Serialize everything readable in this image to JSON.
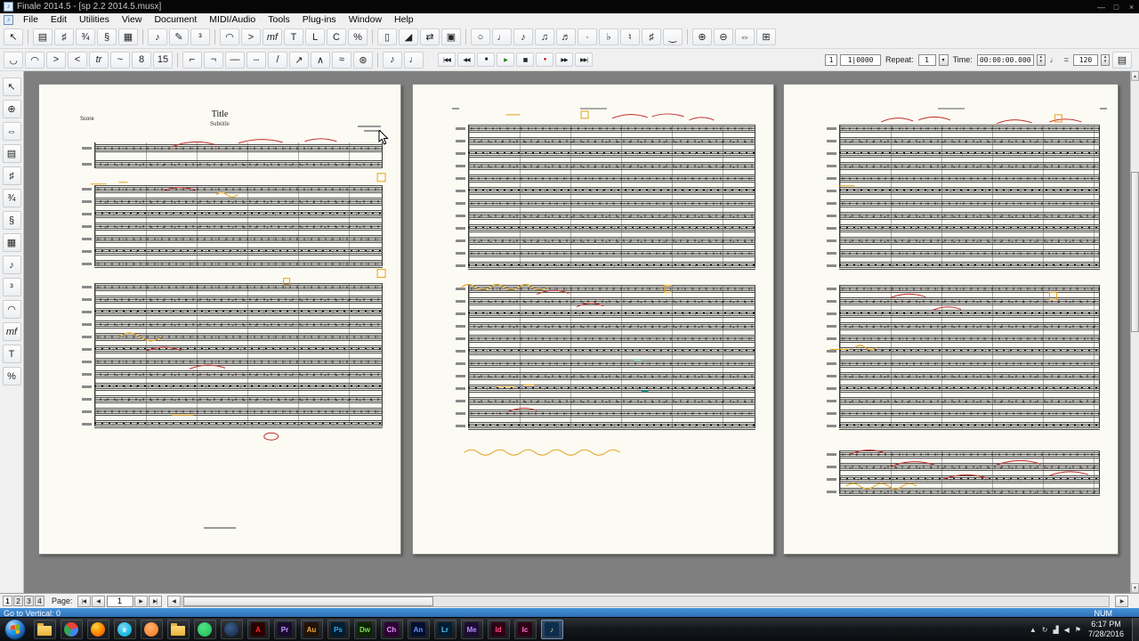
{
  "window": {
    "title": "Finale 2014.5 - [sp 2.2 2014.5.musx]",
    "icon_glyph": "♪",
    "doc_icon_glyph": "♪",
    "controls": {
      "minimize": "—",
      "restore": "□",
      "close": "×"
    }
  },
  "menu": {
    "items": [
      "File",
      "Edit",
      "Utilities",
      "View",
      "Document",
      "MIDI/Audio",
      "Tools",
      "Plug-ins",
      "Window",
      "Help"
    ]
  },
  "toolbar_main": {
    "tools": [
      {
        "name": "selection-tool",
        "glyph": "↖"
      },
      {
        "sep": true
      },
      {
        "name": "staff-tool",
        "glyph": "▤"
      },
      {
        "name": "key-signature-tool",
        "glyph": "♯"
      },
      {
        "name": "time-signature-tool",
        "glyph": "¾"
      },
      {
        "name": "clef-tool",
        "glyph": "§"
      },
      {
        "name": "measure-tool",
        "glyph": "▦"
      },
      {
        "sep": true
      },
      {
        "name": "simple-entry-tool",
        "glyph": "♪"
      },
      {
        "name": "speedy-entry-tool",
        "glyph": "✎"
      },
      {
        "name": "tuplet-tool",
        "glyph": "³"
      },
      {
        "sep": true
      },
      {
        "name": "smart-shape-tool",
        "glyph": "◠"
      },
      {
        "name": "articulation-tool",
        "glyph": ">"
      },
      {
        "name": "expression-tool",
        "glyph": "mf",
        "italic": true
      },
      {
        "name": "text-tool",
        "glyph": "T"
      },
      {
        "name": "lyrics-tool",
        "glyph": "L"
      },
      {
        "name": "chord-tool",
        "glyph": "C"
      },
      {
        "name": "repeat-tool",
        "glyph": "%"
      },
      {
        "sep": true
      },
      {
        "name": "page-layout-tool",
        "glyph": "▯"
      },
      {
        "name": "resize-tool",
        "glyph": "◢"
      },
      {
        "name": "note-mover-tool",
        "glyph": "⇄"
      },
      {
        "name": "graphics-tool",
        "glyph": "▣"
      },
      {
        "sep": true
      },
      {
        "name": "simple-entry-whole-note",
        "glyph": "○"
      },
      {
        "name": "simple-entry-quarter-note",
        "glyph": "♩"
      },
      {
        "name": "simple-entry-eighth-note",
        "glyph": "♪"
      },
      {
        "name": "simple-entry-beamed-notes",
        "glyph": "♫"
      },
      {
        "name": "simple-entry-sixteenth-notes",
        "glyph": "♬"
      },
      {
        "name": "simple-entry-dot",
        "glyph": "·"
      },
      {
        "name": "simple-entry-flat",
        "glyph": "♭"
      },
      {
        "name": "simple-entry-natural",
        "glyph": "♮"
      },
      {
        "name": "simple-entry-sharp",
        "glyph": "♯"
      },
      {
        "name": "simple-entry-tie",
        "glyph": "‿"
      },
      {
        "sep": true
      },
      {
        "name": "zoom-in-tool",
        "glyph": "⊕"
      },
      {
        "name": "zoom-out-tool",
        "glyph": "⊖"
      },
      {
        "name": "hand-grabber-tool",
        "glyph": "⇔"
      },
      {
        "name": "redraw-screen-tool",
        "glyph": "⊞"
      }
    ]
  },
  "toolbar_shape": {
    "tools": [
      {
        "name": "slur-tool",
        "glyph": "◡"
      },
      {
        "name": "dashed-slur-tool",
        "glyph": "◠"
      },
      {
        "name": "decrescendo-tool",
        "glyph": ">"
      },
      {
        "name": "crescendo-tool",
        "glyph": "<"
      },
      {
        "name": "trill-tool",
        "glyph": "tr",
        "italic": true
      },
      {
        "name": "turn-tool",
        "glyph": "~"
      },
      {
        "name": "ottava-tool",
        "glyph": "8"
      },
      {
        "name": "quindicesima-tool",
        "glyph": "15"
      },
      {
        "sep": true
      },
      {
        "name": "bracket-open-tool",
        "glyph": "⌐"
      },
      {
        "name": "bracket-close-tool",
        "glyph": "¬"
      },
      {
        "name": "line-tool",
        "glyph": "—"
      },
      {
        "name": "dashed-line-tool",
        "glyph": "┄"
      },
      {
        "name": "glissando-tool",
        "glyph": "/"
      },
      {
        "name": "tab-slide-tool",
        "glyph": "↗"
      },
      {
        "name": "bend-hat-tool",
        "glyph": "∧"
      },
      {
        "name": "wavy-line-tool",
        "glyph": "≈"
      },
      {
        "name": "custom-line-tool",
        "glyph": "⊛"
      },
      {
        "sep": true
      },
      {
        "name": "midi-tool",
        "glyph": "♪"
      },
      {
        "name": "hyperscribe-tool",
        "glyph": "♩"
      }
    ],
    "transport": [
      {
        "name": "back-to-start-button",
        "glyph": "|◀◀"
      },
      {
        "name": "rewind-button",
        "glyph": "◀◀"
      },
      {
        "name": "stop-button",
        "glyph": "■"
      },
      {
        "name": "play-button",
        "glyph": "▶",
        "color": "#1a7f1a"
      },
      {
        "name": "pause-button",
        "glyph": "▮▮"
      },
      {
        "name": "record-button",
        "glyph": "●",
        "color": "#c00000"
      },
      {
        "name": "fast-forward-button",
        "glyph": "▶▶"
      },
      {
        "name": "go-to-end-button",
        "glyph": "▶▶|"
      }
    ],
    "counters": {
      "measure_a": "1",
      "measure_b": "1|0000",
      "repeat_label": "Repeat:",
      "repeat_value": "1",
      "dropdown_glyph": "▾",
      "time_label": "Time:",
      "time_value": "00:00:00.000",
      "tempo_note": "♩",
      "tempo_equals": "=",
      "tempo_value": "120",
      "spin_up": "▴",
      "spin_down": "▾",
      "settings_glyph": "▤"
    }
  },
  "palette": {
    "tools": [
      {
        "name": "palette-selection-tool",
        "glyph": "↖"
      },
      {
        "name": "palette-zoom-tool",
        "glyph": "⊕"
      },
      {
        "name": "palette-hand-grabber-tool",
        "glyph": "⇔"
      },
      {
        "name": "palette-staff-tool",
        "glyph": "▤"
      },
      {
        "name": "palette-key-signature-tool",
        "glyph": "♯"
      },
      {
        "name": "palette-time-signature-tool",
        "glyph": "¾"
      },
      {
        "name": "palette-clef-tool",
        "glyph": "§"
      },
      {
        "name": "palette-measure-tool",
        "glyph": "▦"
      },
      {
        "name": "palette-note-entry-tool",
        "glyph": "♪"
      },
      {
        "name": "palette-tuplet-tool",
        "glyph": "³"
      },
      {
        "name": "palette-smart-shape-tool",
        "glyph": "◠"
      },
      {
        "name": "palette-expression-tool",
        "glyph": "mf",
        "italic": true
      },
      {
        "name": "palette-text-tool",
        "glyph": "T"
      },
      {
        "name": "palette-repeat-tool",
        "glyph": "%"
      }
    ]
  },
  "score": {
    "annotation_colors": {
      "red": "#c22a2a",
      "orange": "#e3a117",
      "teal": "#17b0a6"
    },
    "pages": [
      {
        "header": {
          "part_label": "Score",
          "title": "Title",
          "subtitle": "Subtitle"
        },
        "systems": [
          {
            "staves": 2,
            "wide": true
          },
          {
            "staves": 7
          },
          {
            "staves": 12
          }
        ]
      },
      {
        "systems": [
          {
            "staves": 12
          },
          {
            "staves": 12
          }
        ]
      },
      {
        "systems": [
          {
            "staves": 12
          },
          {
            "staves": 12
          },
          {
            "staves": 4,
            "gapbig": true
          }
        ]
      }
    ]
  },
  "scrollbars": {
    "up_glyph": "▴",
    "down_glyph": "▾",
    "left_glyph": "◀",
    "right_glyph": "▶"
  },
  "pagebar": {
    "tabs": [
      "1",
      "2",
      "3",
      "4"
    ],
    "active": "1",
    "page_label": "Page:",
    "page_value": "1",
    "first_glyph": "|◀",
    "prev_glyph": "◀",
    "next_glyph": "▶",
    "last_glyph": "▶|"
  },
  "statusbar": {
    "left": "Go to Vertical: 0",
    "num_lock": "NUM"
  },
  "taskbar": {
    "items": [
      {
        "name": "explorer",
        "shape": "folder"
      },
      {
        "name": "chrome",
        "shape": "circle",
        "bg": "conic-gradient(from -45deg,#ea4335 0 33%,#4285f4 0 66%,#34a853 0 100%)"
      },
      {
        "name": "firefox",
        "shape": "circle",
        "bg": "radial-gradient(circle at 35% 30%,#ffd24a,#ff9400 45%,#e3450b)"
      },
      {
        "name": "internet-explorer",
        "shape": "circle",
        "bg": "radial-gradient(circle at 40% 35%,#7fd4f7,#1ebde4 60%,#0a8fc0)",
        "abbr": "e",
        "fg": "#ffffff"
      },
      {
        "name": "media-player",
        "shape": "circle",
        "bg": "radial-gradient(circle at 40% 35%,#ffb26b,#f4701d)"
      },
      {
        "name": "documents-folder",
        "shape": "folder"
      },
      {
        "name": "spotify",
        "shape": "circle",
        "bg": "radial-gradient(circle at 40% 35%,#4fe383,#1db954)"
      },
      {
        "name": "steam",
        "shape": "circle",
        "bg": "radial-gradient(circle at 40% 35%,#3b5e8c,#12233c)"
      },
      {
        "name": "acrobat",
        "shape": "square",
        "bg": "#2a0000",
        "abbr": "A",
        "fg": "#ff2b2b"
      },
      {
        "name": "premiere-pro",
        "shape": "square",
        "bg": "#1a0b2e",
        "abbr": "Pr",
        "fg": "#c79bff"
      },
      {
        "name": "audition",
        "shape": "square",
        "bg": "#231205",
        "abbr": "Au",
        "fg": "#e8a84a"
      },
      {
        "name": "photoshop",
        "shape": "square",
        "bg": "#001d30",
        "abbr": "Ps",
        "fg": "#35a4f4"
      },
      {
        "name": "dreamweaver",
        "shape": "square",
        "bg": "#0d2600",
        "abbr": "Dw",
        "fg": "#7ede5e"
      },
      {
        "name": "character-animator",
        "shape": "square",
        "bg": "#2f0036",
        "abbr": "Ch",
        "fg": "#e79bff"
      },
      {
        "name": "animate",
        "shape": "square",
        "bg": "#00102e",
        "abbr": "An",
        "fg": "#6e8cff"
      },
      {
        "name": "lightroom",
        "shape": "square",
        "bg": "#001d30",
        "abbr": "Lr",
        "fg": "#5fc3f7"
      },
      {
        "name": "media-encoder",
        "shape": "square",
        "bg": "#1c0b33",
        "abbr": "Me",
        "fg": "#b592ff"
      },
      {
        "name": "indesign",
        "shape": "square",
        "bg": "#2e0014",
        "abbr": "Id",
        "fg": "#ff4f87"
      },
      {
        "name": "incopy",
        "shape": "square",
        "bg": "#2e0014",
        "abbr": "Ic",
        "fg": "#ff7bd5"
      },
      {
        "name": "finale",
        "shape": "square",
        "bg": "#0c2d4d",
        "abbr": "♪",
        "fg": "#ffd76b",
        "active": true
      }
    ],
    "tray": [
      {
        "name": "show-hidden-icons-button",
        "glyph": "▲"
      },
      {
        "name": "update-tray-icon",
        "glyph": "↻"
      },
      {
        "name": "network-icon",
        "glyph": "▟"
      },
      {
        "name": "volume-icon",
        "glyph": "◀"
      },
      {
        "name": "action-center-flag-icon",
        "glyph": "⚑"
      }
    ],
    "clock": {
      "time": "6:17 PM",
      "date": "7/28/2016"
    }
  }
}
